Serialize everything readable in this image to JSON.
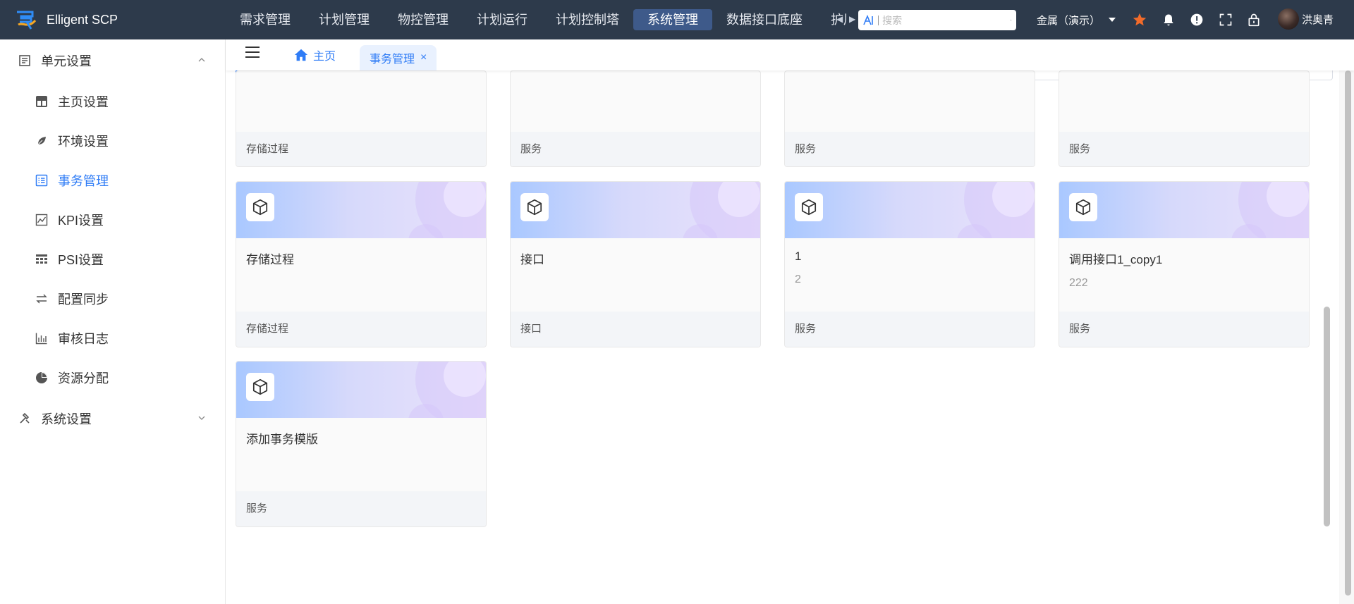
{
  "header": {
    "brand": "Elligent SCP",
    "nav": [
      "需求管理",
      "计划管理",
      "物控管理",
      "计划运行",
      "计划控制塔",
      "系统管理",
      "数据接口底座",
      "扩展"
    ],
    "active_nav": "系统管理",
    "search_placeholder": "搜索",
    "company": "金属（演示）",
    "user_name": "洪奥青"
  },
  "sidebar": {
    "groups": [
      {
        "label": "单元设置",
        "expanded": true,
        "items": [
          {
            "label": "主页设置",
            "icon": "dashboard-icon"
          },
          {
            "label": "环境设置",
            "icon": "leaf-icon"
          },
          {
            "label": "事务管理",
            "icon": "list-icon",
            "active": true
          },
          {
            "label": "KPI设置",
            "icon": "line-chart-icon"
          },
          {
            "label": "PSI设置",
            "icon": "grid-icon"
          },
          {
            "label": "配置同步",
            "icon": "swap-icon"
          },
          {
            "label": "审核日志",
            "icon": "bar-chart-icon"
          },
          {
            "label": "资源分配",
            "icon": "pie-chart-icon"
          }
        ]
      },
      {
        "label": "系统设置",
        "expanded": false
      }
    ]
  },
  "tabs": {
    "home": "主页",
    "active": "事务管理",
    "close": "×"
  },
  "cards_top_row": [
    {
      "footer": "存储过程"
    },
    {
      "footer": "服务"
    },
    {
      "footer": "服务"
    },
    {
      "footer": "服务"
    }
  ],
  "cards": [
    {
      "title": "存储过程",
      "desc": "",
      "footer": "存储过程"
    },
    {
      "title": "接口",
      "desc": "",
      "footer": "接口"
    },
    {
      "title": "1",
      "desc": "2",
      "footer": "服务"
    },
    {
      "title": "调用接口1_copy1",
      "desc": "222",
      "footer": "服务"
    },
    {
      "title": "添加事务模版",
      "desc": "",
      "footer": "服务"
    }
  ],
  "colors": {
    "header_bg": "#2d3a4b",
    "accent": "#2f7cf6",
    "active_nav_bg": "#3e5a8a",
    "star": "#f26b2a"
  }
}
